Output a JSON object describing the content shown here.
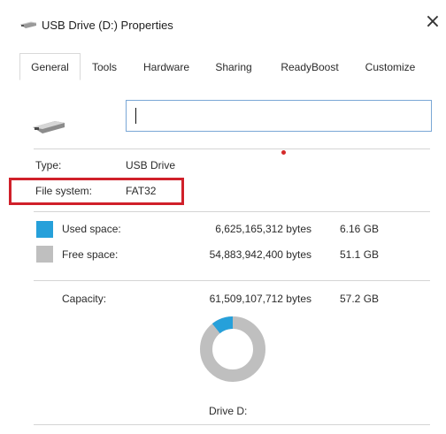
{
  "window": {
    "title": "USB Drive (D:) Properties",
    "close_glyph": "×"
  },
  "tabs": [
    {
      "label": "General",
      "active": true
    },
    {
      "label": "Tools",
      "active": false
    },
    {
      "label": "Hardware",
      "active": false
    },
    {
      "label": "Sharing",
      "active": false
    },
    {
      "label": "ReadyBoost",
      "active": false
    },
    {
      "label": "Customize",
      "active": false
    }
  ],
  "general": {
    "drive_icon": "usb-drive-icon",
    "name_value": "",
    "type_label": "Type:",
    "type_value": "USB Drive",
    "fs_label": "File system:",
    "fs_value": "FAT32",
    "used": {
      "label": "Used space:",
      "bytes": "6,625,165,312 bytes",
      "size": "6.16 GB",
      "color": "#26a0da"
    },
    "free": {
      "label": "Free space:",
      "bytes": "54,883,942,400 bytes",
      "size": "51.1 GB",
      "color": "#bfbfbf"
    },
    "capacity": {
      "label": "Capacity:",
      "bytes": "61,509,107,712 bytes",
      "size": "57.2 GB"
    },
    "donut": {
      "used_fraction": 0.1077,
      "caption": "Drive D:"
    }
  },
  "colors": {
    "highlight": "#d0202a",
    "accent": "#26a0da"
  }
}
